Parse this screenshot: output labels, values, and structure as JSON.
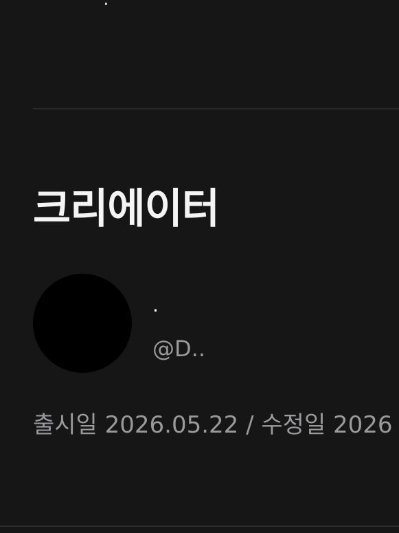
{
  "top_text": "․′′ ′ ′ ′′ ′",
  "section": {
    "title": "크리에이터"
  },
  "creator": {
    "name": "·",
    "handle": "@D.."
  },
  "dates": {
    "text": "출시일 2026.05.22 / 수정일 2026"
  },
  "colors": {
    "background": "#161617",
    "title": "#f4f4f4",
    "secondary_text": "#9a9a9d",
    "avatar": "#000000",
    "divider": "#2b2b2d"
  }
}
